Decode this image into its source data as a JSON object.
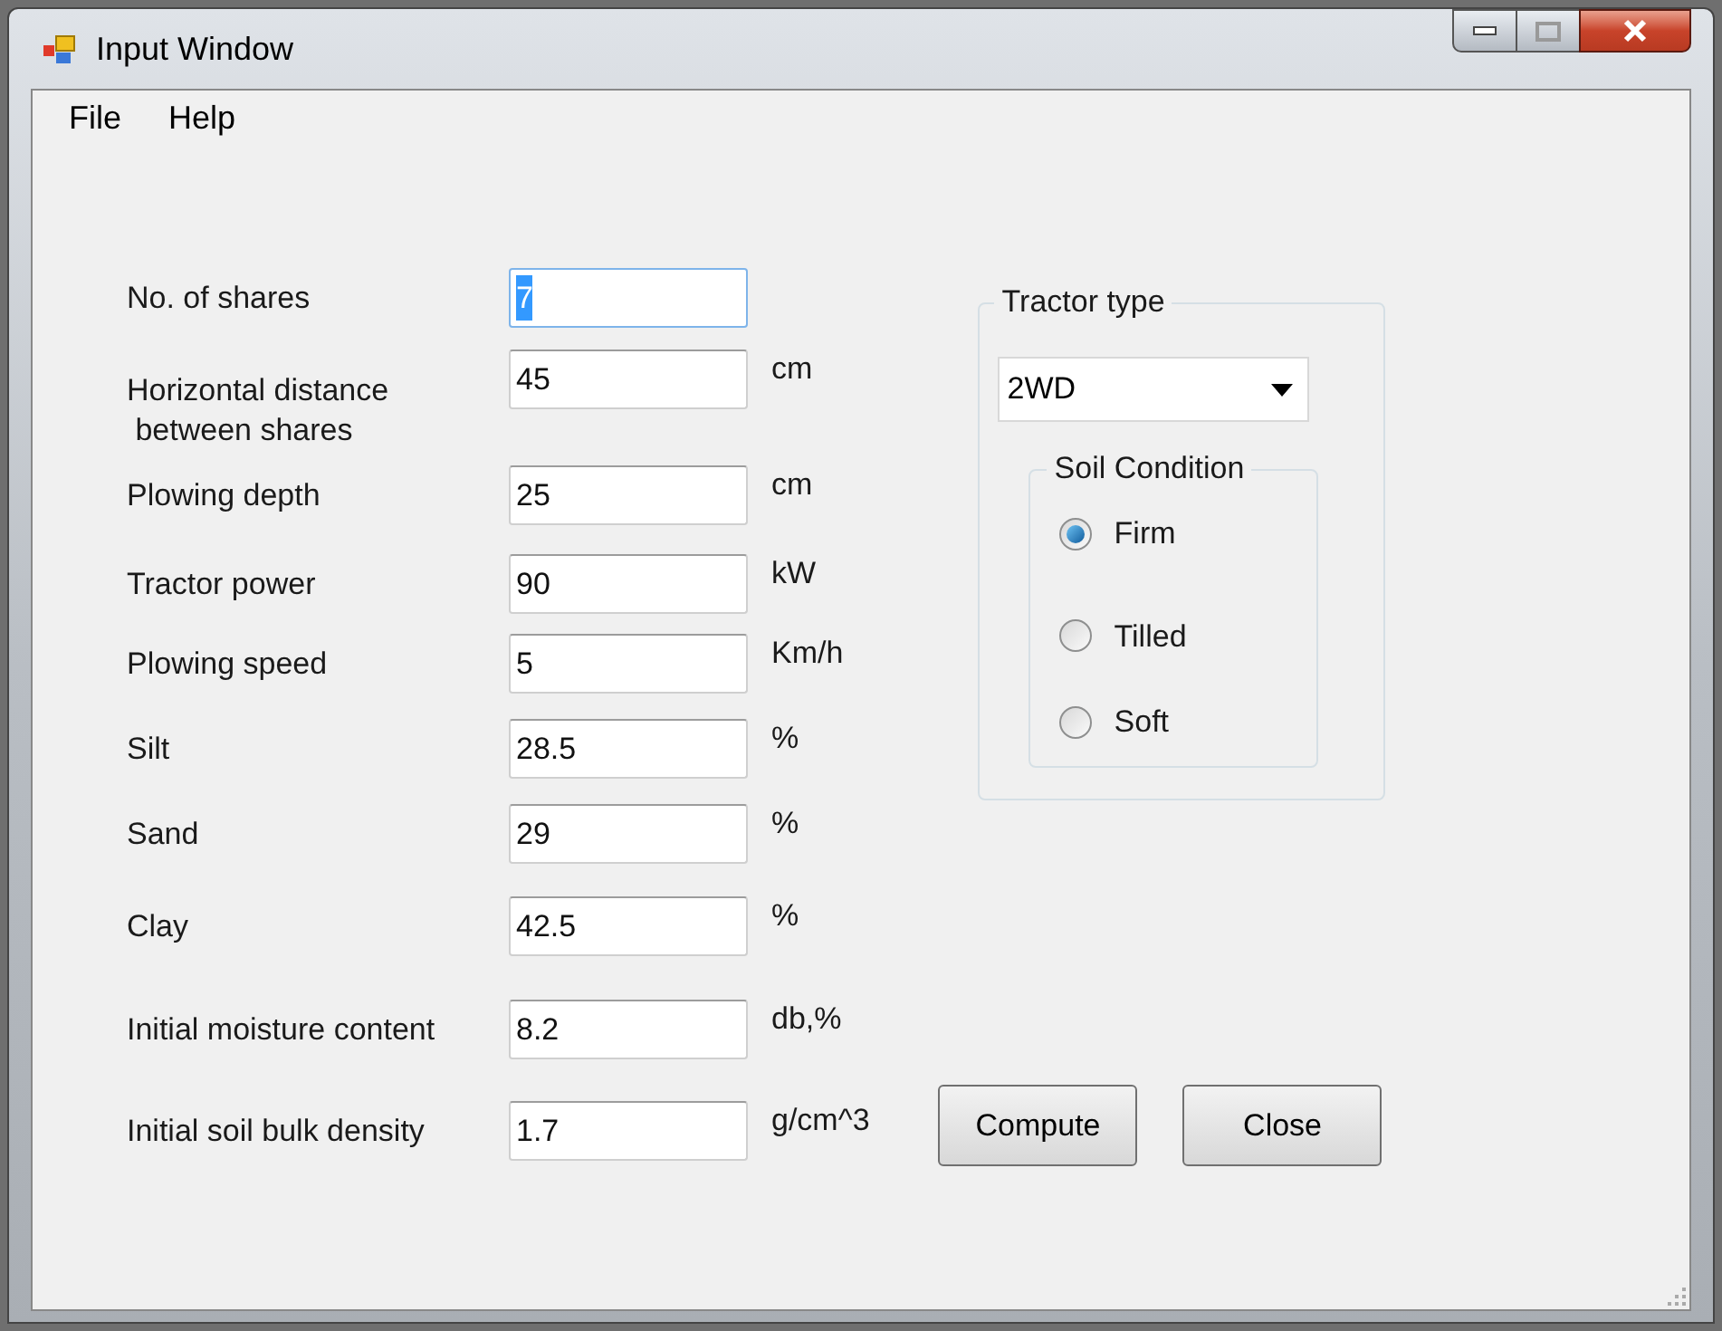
{
  "window": {
    "title": "Input Window"
  },
  "menu": [
    "File",
    "Help"
  ],
  "fields": [
    {
      "label": "No. of shares",
      "value": "7",
      "focused": true
    },
    {
      "label": "Horizontal distance\n between shares",
      "value": "45",
      "unit": "cm",
      "focused": false
    },
    {
      "label": "Plowing depth",
      "value": "25",
      "unit": "cm",
      "focused": false
    },
    {
      "label": "Tractor power",
      "value": "90",
      "unit": "kW",
      "focused": false
    },
    {
      "label": "Plowing speed",
      "value": "5",
      "unit": "Km/h",
      "focused": false
    },
    {
      "label": "Silt",
      "value": "28.5",
      "unit": "%",
      "focused": false
    },
    {
      "label": "Sand",
      "value": "29",
      "unit": "%",
      "focused": false
    },
    {
      "label": "Clay",
      "value": "42.5",
      "unit": "%",
      "focused": false
    },
    {
      "label": "Initial moisture content",
      "value": "8.2",
      "unit": "db,%",
      "focused": false
    },
    {
      "label": "Initial soil bulk density",
      "value": "1.7",
      "unit": "g/cm^3",
      "focused": false
    }
  ],
  "tractor_type": {
    "title": "Tractor type",
    "value": "2WD",
    "soil_condition": {
      "title": "Soil Condition",
      "options": [
        {
          "label": "Firm",
          "selected": true
        },
        {
          "label": "Tilled",
          "selected": false
        },
        {
          "label": "Soft",
          "selected": false
        }
      ]
    }
  },
  "buttons": [
    "Compute",
    "Close"
  ]
}
